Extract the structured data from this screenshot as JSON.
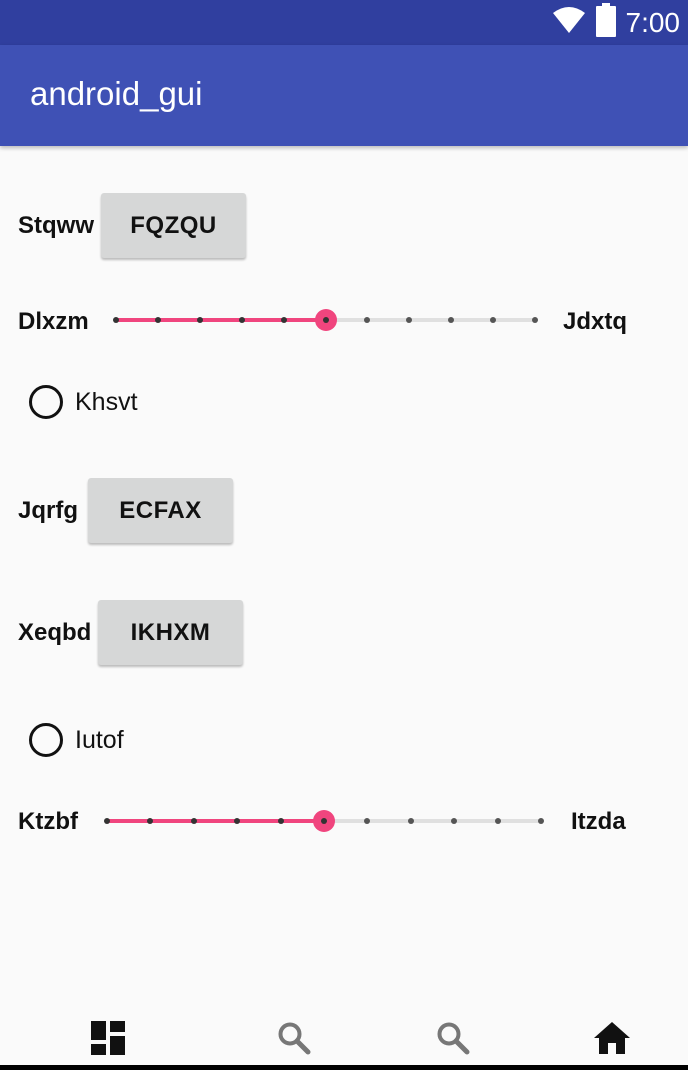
{
  "status_bar": {
    "time": "7:00",
    "icons": [
      "wifi-icon",
      "battery-icon"
    ]
  },
  "app_bar": {
    "title": "android_gui"
  },
  "rows": {
    "row1": {
      "label": "Stqww",
      "button": "FQZQU"
    },
    "slider1": {
      "min_label": "Dlxzm",
      "max_label": "Jdxtq",
      "steps": 10,
      "value": 5
    },
    "radio1": {
      "label": "Khsvt",
      "checked": false
    },
    "row2": {
      "label": "Jqrfg",
      "button": "ECFAX"
    },
    "row3": {
      "label": "Xeqbd",
      "button": "IKHXM"
    },
    "radio2": {
      "label": "Iutof",
      "checked": false
    },
    "slider2": {
      "min_label": "Ktzbf",
      "max_label": "Itzda",
      "steps": 10,
      "value": 5
    }
  },
  "bottom_nav": {
    "items": [
      "dashboard-icon",
      "search-icon",
      "search-icon",
      "home-icon"
    ]
  },
  "colors": {
    "primary": "#3f51b5",
    "primary_dark": "#303f9f",
    "accent": "#f0457e"
  }
}
